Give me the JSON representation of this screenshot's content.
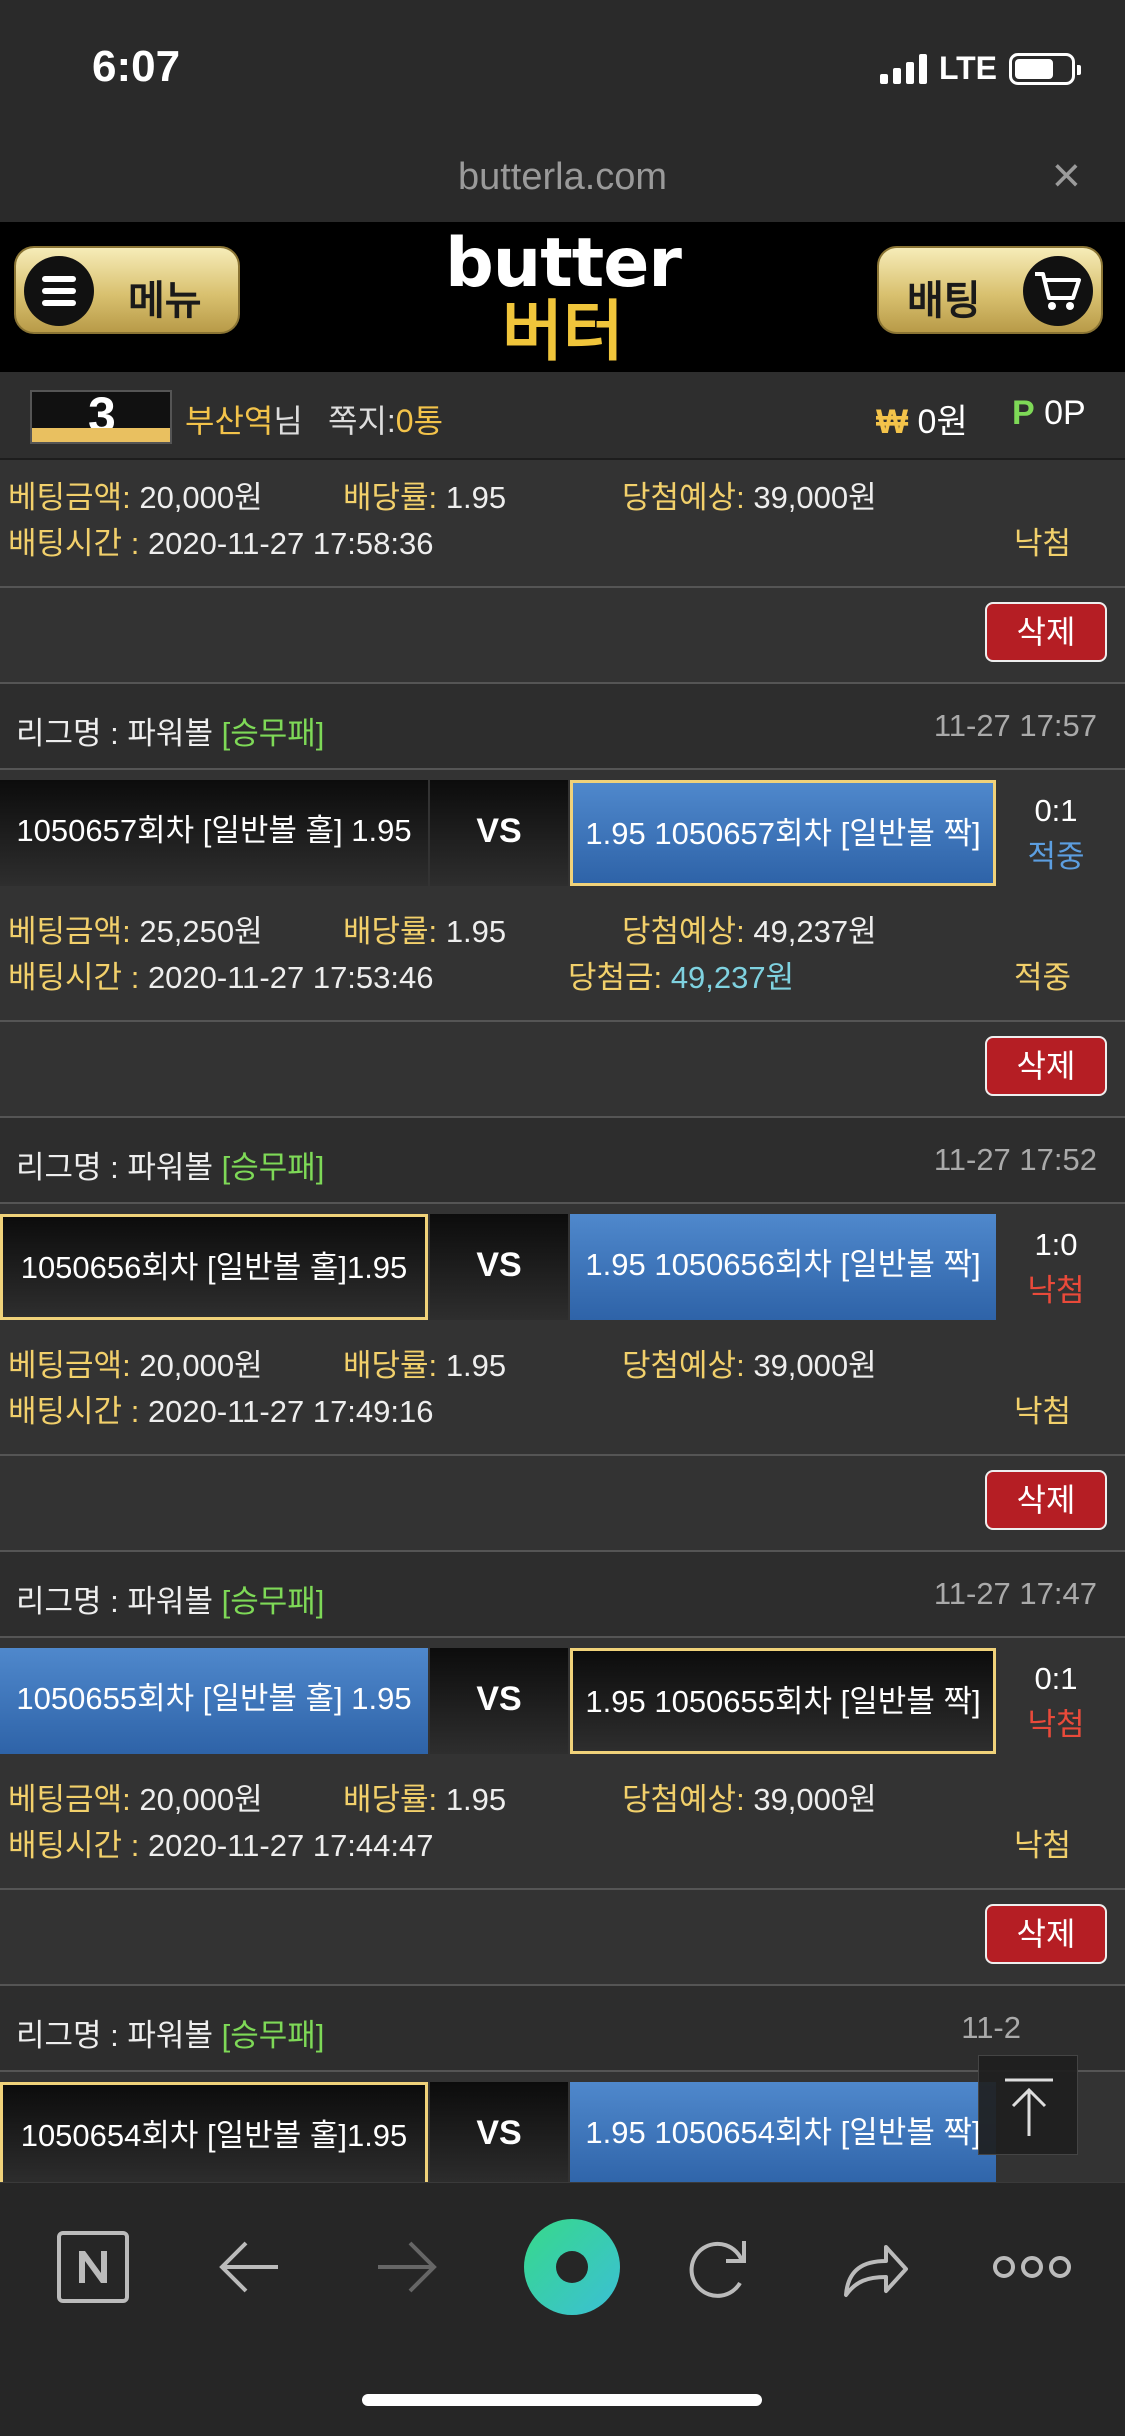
{
  "status": {
    "time": "6:07",
    "network": "LTE"
  },
  "browser": {
    "url": "butterla.com",
    "close": "×"
  },
  "header": {
    "menu_label": "메뉴",
    "logo_en": "butter",
    "logo_ko": "버터",
    "bet_label": "배팅"
  },
  "user": {
    "avatar_text": "3",
    "name": "부산역",
    "suffix": "님",
    "message_label": "쪽지:",
    "message_count": "0통",
    "won_symbol": "₩",
    "won_value": "0원",
    "point_symbol": "P",
    "point_value": "0P"
  },
  "top_info": {
    "amount_label": "베팅금액:",
    "amount": "20,000원",
    "odds_label": "배당률:",
    "odds": "1.95",
    "expected_label": "당첨예상:",
    "expected": "39,000원",
    "time_label": "배팅시간 :",
    "time": "2020-11-27 17:58:36",
    "status": "낙첨"
  },
  "delete_label": "삭제",
  "league_prefix": "리그명 : ",
  "bets": [
    {
      "league": "파워볼",
      "tag": "[승무패]",
      "time": "11-27 17:57",
      "home": "1050657회차 [일반볼 홀] 1.95",
      "vs": "VS",
      "away": "1.95 1050657회차 [일반볼 짝]",
      "score": "0:1",
      "result": "적중",
      "amount": "25,250원",
      "odds": "1.95",
      "expected": "49,237원",
      "bet_time": "2020-11-27 17:53:46",
      "paid_label": "당첨금:",
      "paid": "49,237원",
      "status": "적중"
    },
    {
      "league": "파워볼",
      "tag": "[승무패]",
      "time": "11-27 17:52",
      "home": "1050656회차 [일반볼 홀]1.95",
      "vs": "VS",
      "away": "1.95 1050656회차 [일반볼 짝]",
      "score": "1:0",
      "result": "낙첨",
      "amount": "20,000원",
      "odds": "1.95",
      "expected": "39,000원",
      "bet_time": "2020-11-27 17:49:16",
      "status": "낙첨"
    },
    {
      "league": "파워볼",
      "tag": "[승무패]",
      "time": "11-27 17:47",
      "home": "1050655회차 [일반볼 홀] 1.95",
      "vs": "VS",
      "away": "1.95 1050655회차 [일반볼 짝]",
      "score": "0:1",
      "result": "낙첨",
      "amount": "20,000원",
      "odds": "1.95",
      "expected": "39,000원",
      "bet_time": "2020-11-27 17:44:47",
      "status": "낙첨"
    },
    {
      "league": "파워볼",
      "tag": "[승무패]",
      "time": "11-2",
      "home": "1050654회차 [일반볼 홀]1.95",
      "vs": "VS",
      "away": "1.95 1050654회차 [일반볼 짝]"
    }
  ],
  "labels": {
    "amount": "베팅금액:",
    "odds": "배당률:",
    "expected": "당첨예상:",
    "bet_time": "배팅시간 :"
  },
  "colors": {
    "accent_gold": "#f3c34a",
    "fail_red": "#e94a3a",
    "win_blue": "#5c9ee0",
    "delete_red": "#b51e24",
    "league_green": "#7ed957"
  },
  "icons": [
    "menu-icon",
    "cart-icon",
    "naver-icon",
    "back-arrow-icon",
    "forward-arrow-icon",
    "home-circle-icon",
    "refresh-icon",
    "share-icon",
    "more-icon",
    "scroll-top-icon"
  ]
}
